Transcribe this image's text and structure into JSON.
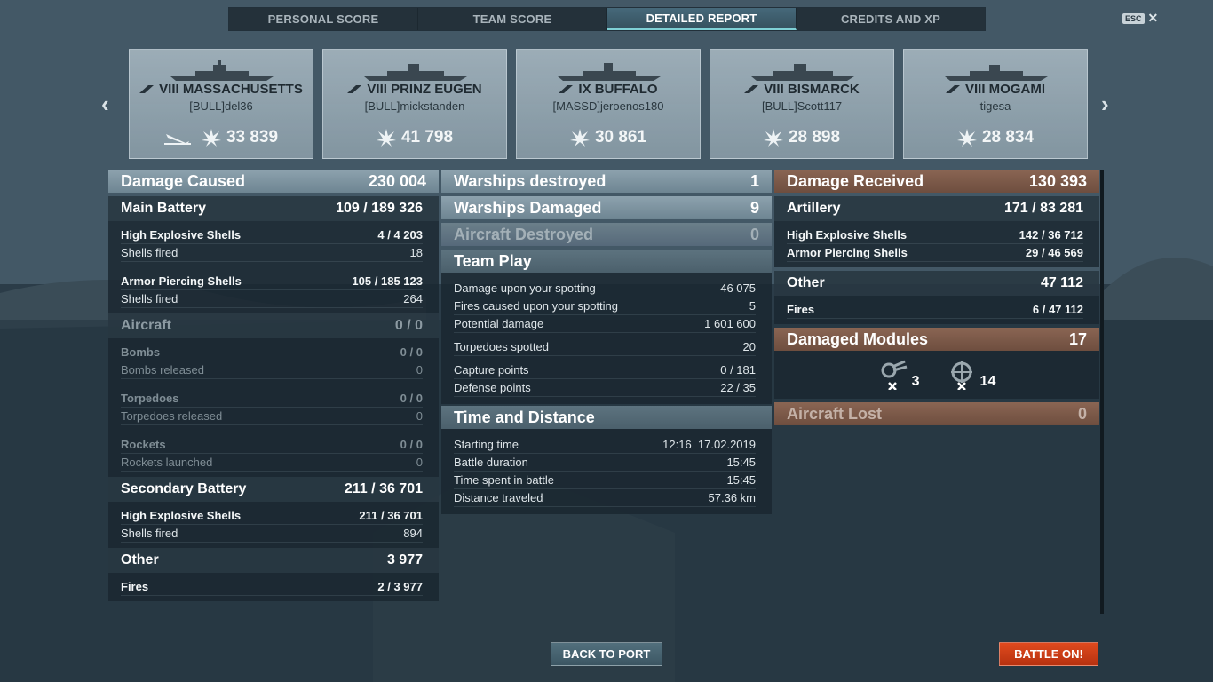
{
  "tabs": [
    {
      "label": "PERSONAL SCORE"
    },
    {
      "label": "TEAM SCORE"
    },
    {
      "label": "DETAILED REPORT"
    },
    {
      "label": "CREDITS AND XP"
    }
  ],
  "esc": {
    "key": "ESC",
    "close": "✕"
  },
  "nav": {
    "prev": "‹",
    "next": "›"
  },
  "ships": [
    {
      "tier": "VIII",
      "name": "MASSACHUSETTS",
      "player": "[BULL]del36",
      "damage": "33 839"
    },
    {
      "tier": "VIII",
      "name": "PRINZ EUGEN",
      "player": "[BULL]mickstanden",
      "damage": "41 798"
    },
    {
      "tier": "IX",
      "name": "BUFFALO",
      "player": "[MASSD]jeroenos180",
      "damage": "30 861"
    },
    {
      "tier": "VIII",
      "name": "BISMARCK",
      "player": "[BULL]Scott117",
      "damage": "28 898"
    },
    {
      "tier": "VIII",
      "name": "MOGAMI",
      "player": "tigesa",
      "damage": "28 834"
    }
  ],
  "left": {
    "damage_caused": {
      "label": "Damage Caused",
      "value": "230 004"
    },
    "main_battery": {
      "label": "Main Battery",
      "hits": "109",
      "sep": "/",
      "damage": "189 326"
    },
    "mb_he": {
      "label": "High Explosive Shells",
      "hits": "4",
      "sep": "/",
      "damage": "4 203"
    },
    "mb_he_fired": {
      "label": "Shells fired",
      "value": "18"
    },
    "mb_ap": {
      "label": "Armor Piercing Shells",
      "hits": "105",
      "sep": "/",
      "damage": "185 123"
    },
    "mb_ap_fired": {
      "label": "Shells fired",
      "value": "264"
    },
    "aircraft": {
      "label": "Aircraft",
      "hits": "0",
      "sep": "/",
      "damage": "0"
    },
    "bombs": {
      "label": "Bombs",
      "hits": "0",
      "sep": "/",
      "damage": "0"
    },
    "bombs_released": {
      "label": "Bombs released",
      "value": "0"
    },
    "torpedoes": {
      "label": "Torpedoes",
      "hits": "0",
      "sep": "/",
      "damage": "0"
    },
    "torpedoes_released": {
      "label": "Torpedoes released",
      "value": "0"
    },
    "rockets": {
      "label": "Rockets",
      "hits": "0",
      "sep": "/",
      "damage": "0"
    },
    "rockets_launched": {
      "label": "Rockets launched",
      "value": "0"
    },
    "secondary": {
      "label": "Secondary Battery",
      "hits": "211",
      "sep": "/",
      "damage": "36 701"
    },
    "sec_he": {
      "label": "High Explosive Shells",
      "hits": "211",
      "sep": "/",
      "damage": "36 701"
    },
    "sec_fired": {
      "label": "Shells fired",
      "value": "894"
    },
    "other": {
      "label": "Other",
      "value": "3 977"
    },
    "fires": {
      "label": "Fires",
      "hits": "2",
      "sep": "/",
      "damage": "3 977"
    }
  },
  "middle": {
    "warships_destroyed": {
      "label": "Warships destroyed",
      "value": "1"
    },
    "warships_damaged": {
      "label": "Warships Damaged",
      "value": "9"
    },
    "aircraft_destroyed": {
      "label": "Aircraft Destroyed",
      "value": "0"
    },
    "team_play": {
      "label": "Team Play"
    },
    "spotting_damage": {
      "label": "Damage upon your spotting",
      "value": "46 075"
    },
    "spotting_fires": {
      "label": "Fires caused upon your spotting",
      "value": "5"
    },
    "potential_damage": {
      "label": "Potential damage",
      "value": "1 601 600"
    },
    "torpedoes_spotted": {
      "label": "Torpedoes spotted",
      "value": "20"
    },
    "capture_points": {
      "label": "Capture points",
      "value": "0 / 181"
    },
    "defense_points": {
      "label": "Defense points",
      "value": "22 / 35"
    },
    "time_distance": {
      "label": "Time and Distance"
    },
    "starting_time": {
      "label": "Starting time",
      "value": "12:16  17.02.2019"
    },
    "battle_duration": {
      "label": "Battle duration",
      "value": "15:45"
    },
    "time_in_battle": {
      "label": "Time spent in battle",
      "value": "15:45"
    },
    "distance": {
      "label": "Distance traveled",
      "value": "57.36 km"
    }
  },
  "right": {
    "damage_received": {
      "label": "Damage Received",
      "value": "130 393"
    },
    "artillery": {
      "label": "Artillery",
      "hits": "171",
      "sep": "/",
      "damage": "83 281"
    },
    "art_he": {
      "label": "High Explosive Shells",
      "hits": "142",
      "sep": "/",
      "damage": "36 712"
    },
    "art_ap": {
      "label": "Armor Piercing Shells",
      "hits": "29",
      "sep": "/",
      "damage": "46 569"
    },
    "other": {
      "label": "Other",
      "value": "47 112"
    },
    "fires": {
      "label": "Fires",
      "hits": "6",
      "sep": "/",
      "damage": "47 112"
    },
    "damaged_modules": {
      "label": "Damaged Modules",
      "value": "17"
    },
    "modules": [
      {
        "icon": "gun-module-icon",
        "count": "3"
      },
      {
        "icon": "steering-module-icon",
        "count": "14"
      }
    ],
    "aircraft_lost": {
      "label": "Aircraft Lost",
      "value": "0"
    }
  },
  "buttons": {
    "back_to_port": "BACK TO PORT",
    "battle_on": "BATTLE ON!"
  },
  "colors": {
    "accent": "#7fd1d6",
    "battle_button": "#d8421a",
    "damage_received_header": "#7d5a49"
  }
}
